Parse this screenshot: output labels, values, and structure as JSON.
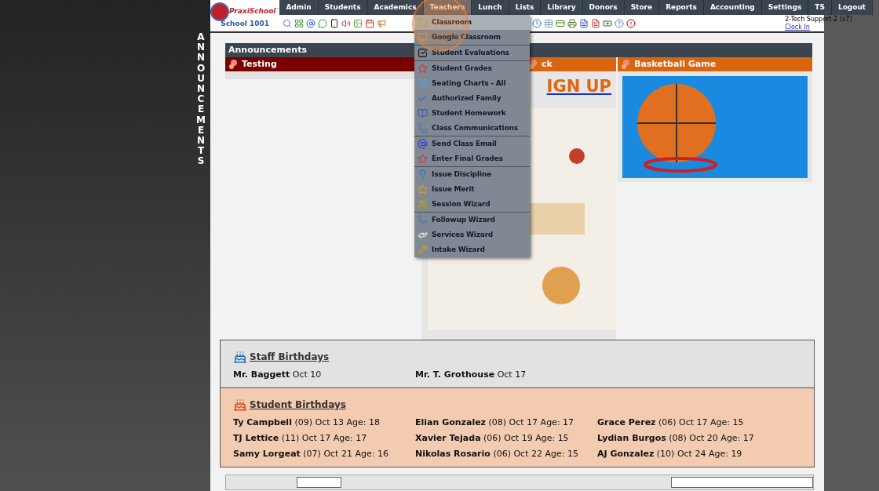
{
  "side_banner": "ANNOUNCEMENTS",
  "logo": {
    "brand": "PraxiSchool",
    "tm": "™",
    "school": "School 1001"
  },
  "nav": [
    {
      "label": "Admin",
      "selected": false
    },
    {
      "label": "Students",
      "selected": false
    },
    {
      "label": "Academics",
      "selected": false
    },
    {
      "label": "Teachers",
      "selected": true
    },
    {
      "label": "Lunch",
      "selected": false
    },
    {
      "label": "Lists",
      "selected": false
    },
    {
      "label": "Library",
      "selected": false
    },
    {
      "label": "Donors",
      "selected": false
    },
    {
      "label": "Store",
      "selected": false
    },
    {
      "label": "Reports",
      "selected": false
    },
    {
      "label": "Accounting",
      "selected": false
    },
    {
      "label": "Settings",
      "selected": false
    },
    {
      "label": "TS",
      "selected": false
    },
    {
      "label": "Logout",
      "selected": false
    }
  ],
  "user": {
    "name": "2-Tech Support-2 (s7)",
    "link": "Clock In"
  },
  "teachers_menu": [
    [
      {
        "label": "Classroom",
        "selected": true
      },
      {
        "label": "Google Classroom",
        "selected": false
      }
    ],
    [
      {
        "label": "Student Evaluations",
        "selected": false
      }
    ],
    [
      {
        "label": "Student Grades",
        "selected": false
      },
      {
        "label": "Seating Charts - All",
        "selected": false
      },
      {
        "label": "Authorized Family",
        "selected": false
      },
      {
        "label": "Student Homework",
        "selected": false
      },
      {
        "label": "Class Communications",
        "selected": false
      }
    ],
    [
      {
        "label": "Send Class Email",
        "selected": false
      },
      {
        "label": "Enter Final Grades",
        "selected": false
      }
    ],
    [
      {
        "label": "Issue Discipline",
        "selected": false
      },
      {
        "label": "Issue Merit",
        "selected": false
      },
      {
        "label": "Session Wizard",
        "selected": false
      }
    ],
    [
      {
        "label": "Followup Wizard",
        "selected": false
      },
      {
        "label": "Services Wizard",
        "selected": false
      },
      {
        "label": "Intake Wizard",
        "selected": false
      }
    ]
  ],
  "announcements": {
    "title": "Announcements",
    "columns": [
      {
        "title": "Testing",
        "color": "#7a0000",
        "kind": "empty"
      },
      {
        "title": "ck",
        "color": "#d9650f",
        "kind": "flyer",
        "link": "IGN UP"
      },
      {
        "title": "Basketball Game",
        "color": "#d9650f",
        "kind": "poster"
      }
    ]
  },
  "staff_birthdays": {
    "title": "Staff Birthdays",
    "people": [
      {
        "name": "Mr. Baggett",
        "detail": "Oct 10"
      },
      {
        "name": "Mr. T. Grothouse",
        "detail": "Oct 17"
      }
    ]
  },
  "student_birthdays": {
    "title": "Student Birthdays",
    "people": [
      {
        "name": "Ty Campbell",
        "detail": "(09) Oct 13 Age: 18"
      },
      {
        "name": "Elian Gonzalez",
        "detail": "(08) Oct 17 Age: 17"
      },
      {
        "name": "Grace Perez",
        "detail": "(06) Oct 17 Age: 15"
      },
      {
        "name": "TJ Lettice",
        "detail": "(11) Oct 17 Age: 17"
      },
      {
        "name": "Xavier Tejada",
        "detail": "(06) Oct 19 Age: 15"
      },
      {
        "name": "Lydian Burgos",
        "detail": "(08) Oct 20 Age: 17"
      },
      {
        "name": "Samy Lorgeat",
        "detail": "(07) Oct 21 Age: 16"
      },
      {
        "name": "Nikolas Rosario",
        "detail": "(06) Oct 22 Age: 15"
      },
      {
        "name": "AJ Gonzalez",
        "detail": "(10) Oct 24 Age: 19"
      }
    ]
  }
}
